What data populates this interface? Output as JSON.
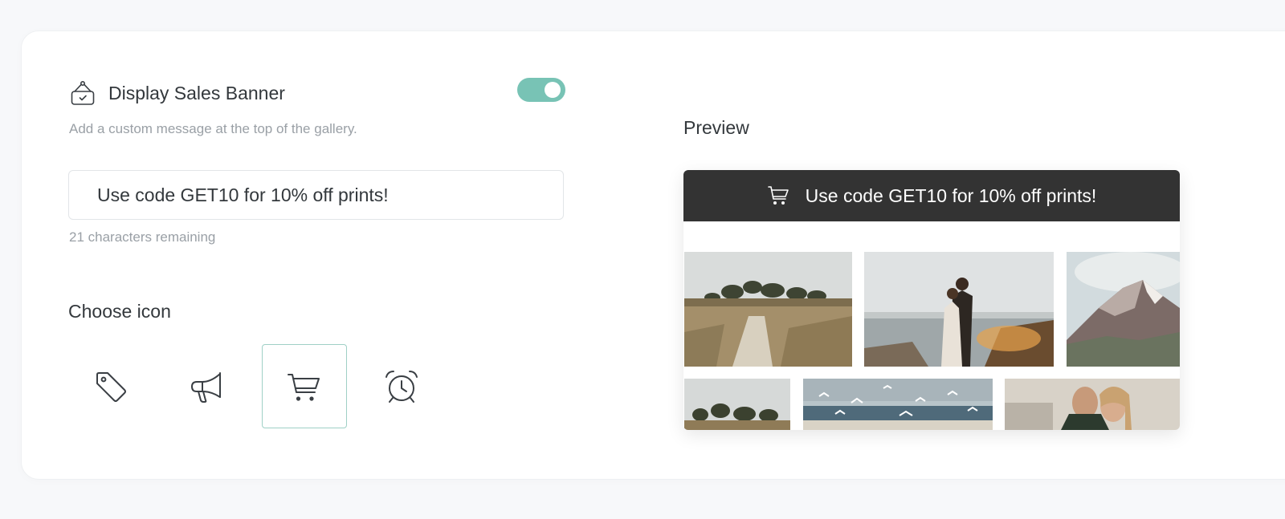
{
  "banner_setting": {
    "title": "Display Sales Banner",
    "subtitle": "Add a custom message at the top of the gallery.",
    "title_icon": "store-sign-icon",
    "enabled": true,
    "accent_color": "#78c3b5"
  },
  "message": {
    "value": "Use code GET10 for 10% off prints!",
    "remaining": "21 characters remaining"
  },
  "icon_picker": {
    "label": "Choose icon",
    "options": [
      "tag-icon",
      "megaphone-icon",
      "cart-icon",
      "alarm-clock-icon"
    ],
    "selected": "cart-icon"
  },
  "preview": {
    "label": "Preview",
    "banner_text": "Use code GET10 for 10% off prints!",
    "banner_color": "#333333",
    "banner_icon": "cart-icon",
    "photos": [
      "coastal-path-photo",
      "couple-at-sea-photo",
      "mountain-peak-photo",
      "trees-landscape-photo",
      "seagulls-beach-photo",
      "couple-portrait-photo"
    ]
  }
}
